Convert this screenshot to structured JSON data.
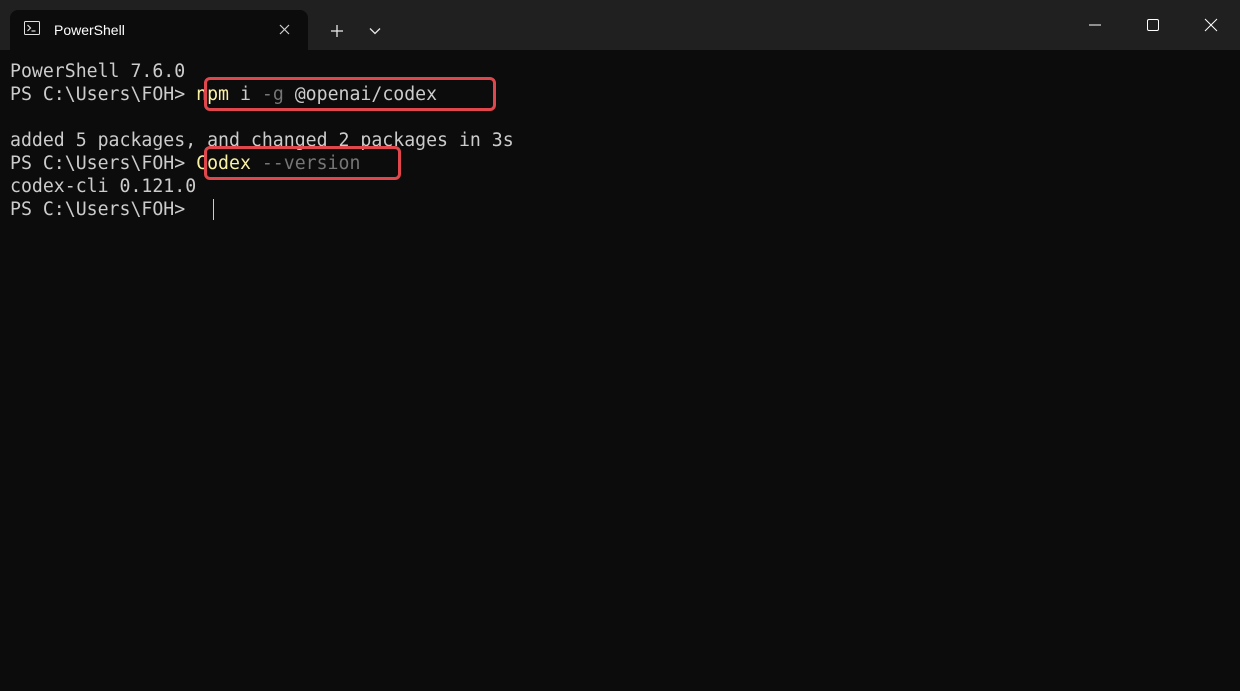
{
  "window": {
    "tab_title": "PowerShell",
    "tab_icon": "powershell-icon",
    "buttons": {
      "close_tab": "close-icon",
      "new_tab": "plus-icon",
      "dropdown": "chevron-down-icon",
      "minimize": "minimize-icon",
      "maximize": "maximize-icon",
      "close_window": "close-icon"
    }
  },
  "terminal": {
    "colors": {
      "background": "#0c0c0c",
      "text": "#cccccc",
      "command": "#f9f1a5",
      "parameter": "#767676",
      "highlight_box": "#e0474c"
    },
    "banner": "PowerShell 7.6.0",
    "lines": [
      {
        "prompt": "PS C:\\Users\\FOH> ",
        "command": "npm",
        "args": [
          " i ",
          "-g",
          " @openai/codex"
        ]
      },
      {
        "output": "added 5 packages, and changed 2 packages in 3s"
      },
      {
        "prompt": "PS C:\\Users\\FOH> ",
        "command": "Codex",
        "args": [
          " ",
          "--version"
        ]
      },
      {
        "output": "codex-cli 0.121.0"
      },
      {
        "prompt": "PS C:\\Users\\FOH> "
      }
    ]
  }
}
